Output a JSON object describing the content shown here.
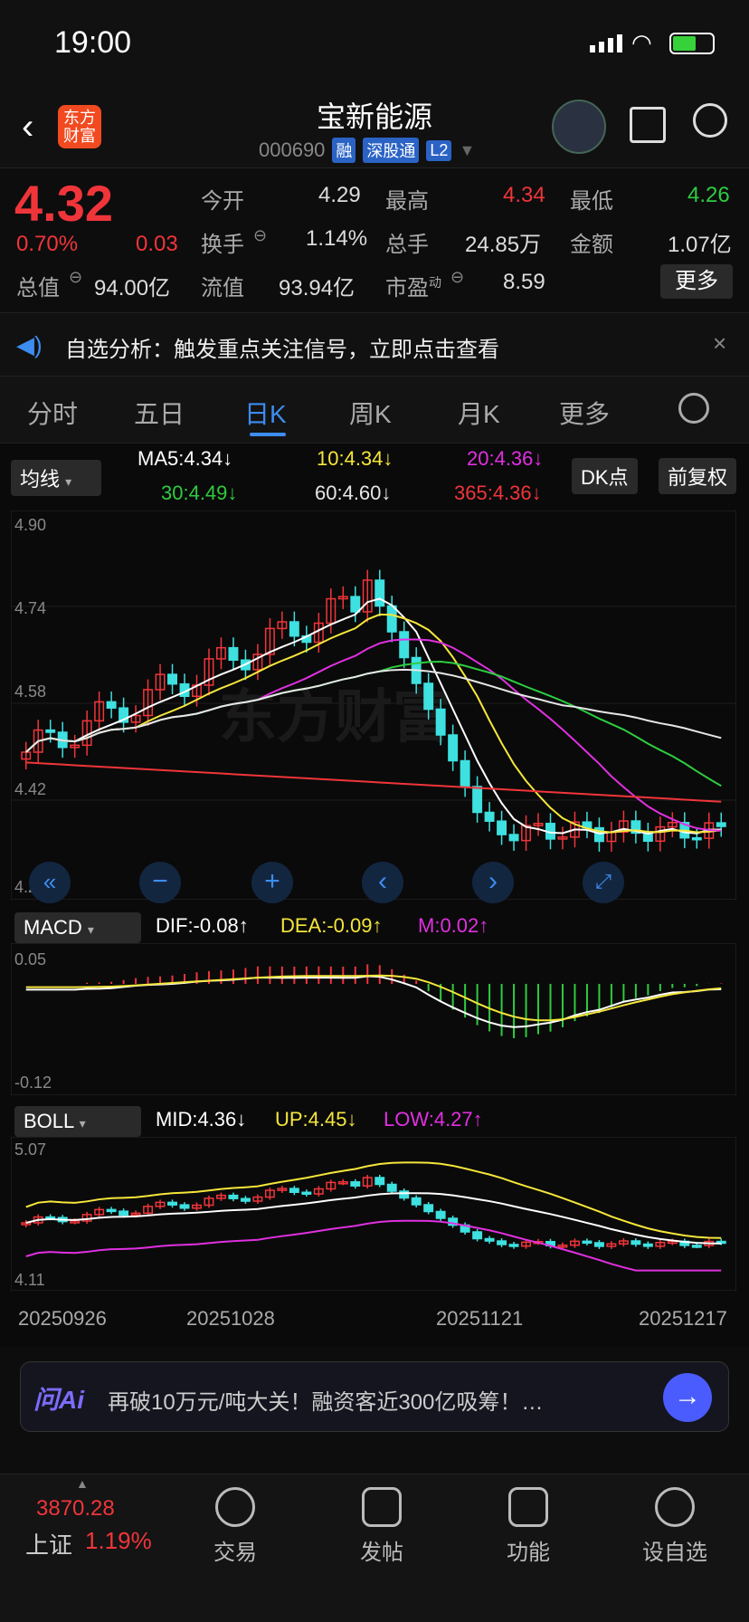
{
  "status_bar": {
    "time": "19:00"
  },
  "header": {
    "title": "宝新能源",
    "code": "000690",
    "badges": [
      "融",
      "深股通",
      "L2"
    ],
    "logo_text": "东方财富"
  },
  "quote": {
    "price": "4.32",
    "change_pct": "0.70%",
    "change_amt": "0.03",
    "fields": [
      {
        "label": "今开",
        "value": "4.29"
      },
      {
        "label": "最高",
        "value": "4.34"
      },
      {
        "label": "最低",
        "value": "4.26"
      },
      {
        "label": "换手",
        "value": "1.14%"
      },
      {
        "label": "总手",
        "value": "24.85万"
      },
      {
        "label": "金额",
        "value": "1.07亿"
      },
      {
        "label": "总值",
        "value": "94.00亿"
      },
      {
        "label": "流值",
        "value": "93.94亿"
      },
      {
        "label": "市盈",
        "value": "8.59"
      }
    ],
    "pe_sup": "动",
    "more_label": "更多"
  },
  "notice": {
    "text": "自选分析：触发重点关注信号，立即点击查看"
  },
  "tabs": [
    "分时",
    "五日",
    "日K",
    "周K",
    "月K",
    "更多"
  ],
  "active_tab": "日K",
  "chart_controls": {
    "ma_select": "均线",
    "dk_label": "DK点",
    "adjust_label": "前复权",
    "macd_select": "MACD",
    "boll_select": "BOLL"
  },
  "ma_legend": [
    {
      "text": "MA5:4.34",
      "arrow": "↓",
      "color": "#ffffff"
    },
    {
      "text": "10:4.34",
      "arrow": "↓",
      "color": "#f5e63b"
    },
    {
      "text": "20:4.36",
      "arrow": "↓",
      "color": "#e030e0"
    },
    {
      "text": "30:4.49",
      "arrow": "↓",
      "color": "#2ecc40"
    },
    {
      "text": "60:4.60",
      "arrow": "↓",
      "color": "#e6e6e6"
    },
    {
      "text": "365:4.36",
      "arrow": "↓",
      "color": "#f0353a"
    }
  ],
  "macd_legend": [
    {
      "text": "DIF:-0.08",
      "arrow": "↑",
      "color": "#ffffff"
    },
    {
      "text": "DEA:-0.09",
      "arrow": "↑",
      "color": "#f5e63b"
    },
    {
      "text": "M:0.02",
      "arrow": "↑",
      "color": "#e030e0"
    }
  ],
  "boll_legend": [
    {
      "text": "MID:4.36",
      "arrow": "↓",
      "color": "#ffffff"
    },
    {
      "text": "UP:4.45",
      "arrow": "↓",
      "color": "#f5e63b"
    },
    {
      "text": "LOW:4.27",
      "arrow": "↑",
      "color": "#e030e0"
    }
  ],
  "chart_data": [
    {
      "type": "candlestick",
      "y_ticks": [
        "4.90",
        "4.74",
        "4.58",
        "4.42",
        "4.26"
      ],
      "ylim": [
        4.26,
        4.9
      ],
      "watermark": "东方财富",
      "signals": [
        "3",
        "4",
        "5",
        "6",
        "7",
        "8",
        "9",
        "1",
        "2",
        "3",
        "4",
        "5",
        "7",
        "8",
        "6",
        "9",
        "B",
        "B",
        "S"
      ]
    },
    {
      "type": "bar",
      "name": "MACD",
      "y_ticks": [
        "0.05",
        "-0.12"
      ],
      "ylim": [
        -0.12,
        0.05
      ]
    },
    {
      "type": "candlestick",
      "name": "BOLL",
      "y_ticks": [
        "5.07",
        "4.11"
      ],
      "ylim": [
        4.11,
        5.07
      ],
      "x_ticks": [
        "20250926",
        "20251028",
        "20251121",
        "20251217"
      ]
    }
  ],
  "ai_bar": {
    "logo": "问Ai",
    "text": "再破10万元/吨大关！融资客近300亿吸筹！…"
  },
  "tabbar": {
    "index_value": "3870.28",
    "index_name": "上证",
    "index_change": "1.19%",
    "items": [
      "交易",
      "发帖",
      "功能",
      "设自选"
    ]
  },
  "colors": {
    "up": "#f0353a",
    "down": "#2ecc40",
    "accent": "#3d8cf0",
    "bear_candle": "#3ee0e0"
  }
}
